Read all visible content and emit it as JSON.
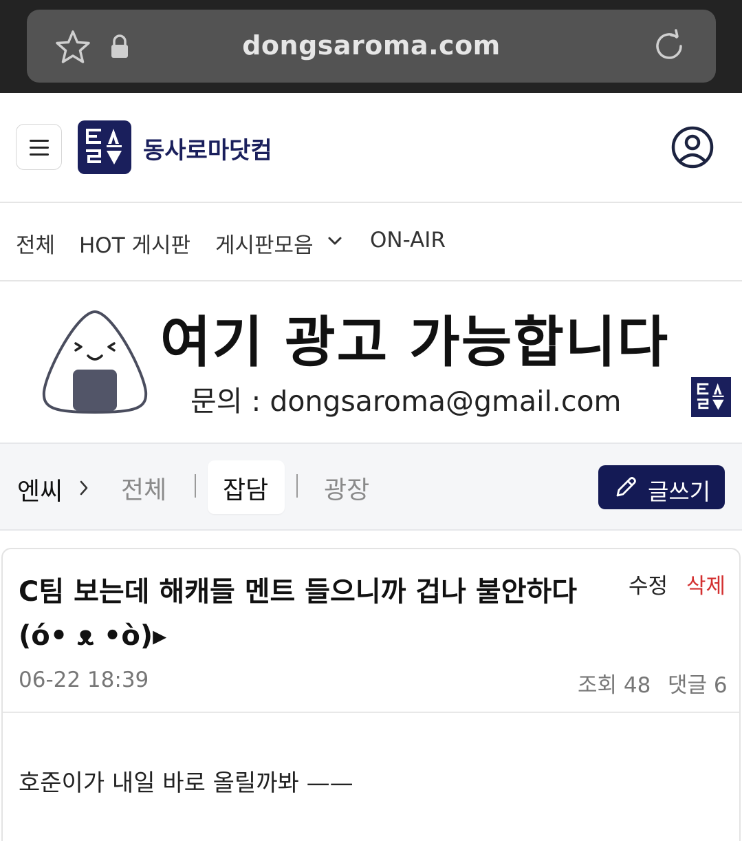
{
  "browser": {
    "url": "dongsaroma.com"
  },
  "header": {
    "site_name": "동사로마닷컴"
  },
  "nav": {
    "items": [
      "전체",
      "HOT 게시판",
      "게시판모음",
      "ON-AIR"
    ]
  },
  "ad": {
    "headline": "여기 광고 가능합니다",
    "contact": "문의 : dongsaroma@gmail.com"
  },
  "board": {
    "crumb": "엔씨",
    "tabs": [
      "전체",
      "잡담",
      "광장"
    ],
    "active_tab": "잡담",
    "write_label": "글쓰기"
  },
  "post": {
    "title": "C팀 보는데 해캐들 멘트 들으니까 겁나 불안하다 (ό• ᴥ •ò)▸",
    "edit_label": "수정",
    "delete_label": "삭제",
    "date": "06-22 18:39",
    "views": "조회 48",
    "comments": "댓글 6",
    "body": "호준이가 내일 바로 올릴까봐 ——"
  },
  "colors": {
    "brand_navy": "#1a1f5c",
    "write_button": "#141a55",
    "delete_red": "#d32f2f"
  },
  "icons": [
    "star-icon",
    "lock-icon",
    "reload-icon",
    "hamburger-menu-icon",
    "site-logo",
    "profile-icon",
    "chevron-down-icon",
    "chevron-right-icon",
    "pencil-icon",
    "mascot-icon"
  ]
}
